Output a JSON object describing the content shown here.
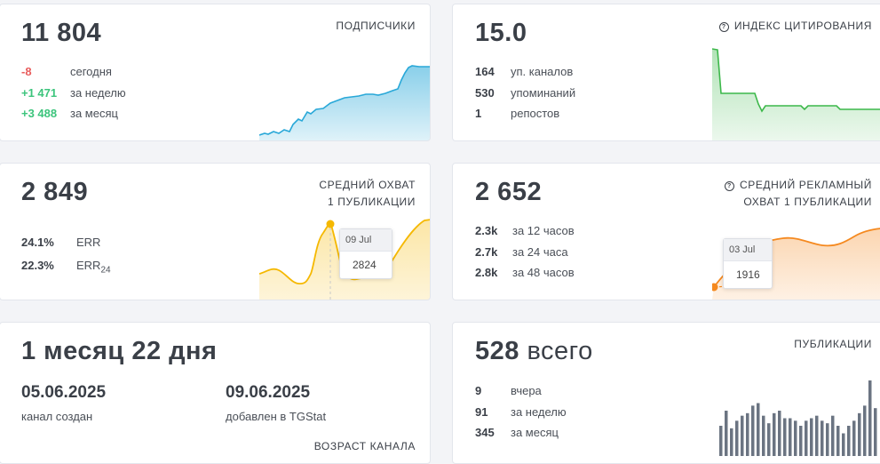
{
  "subscribers": {
    "value": "11 804",
    "label": "ПОДПИСЧИКИ",
    "rows": [
      {
        "num": "-8",
        "text": "сегодня"
      },
      {
        "num": "+1 471",
        "text": "за неделю"
      },
      {
        "num": "+3 488",
        "text": "за месяц"
      }
    ],
    "color": "#29a8d8"
  },
  "citation": {
    "value": "15.0",
    "label": "ИНДЕКС ЦИТИРОВАНИЯ",
    "icon": "question-circle-icon",
    "rows": [
      {
        "num": "164",
        "text": "уп. каналов"
      },
      {
        "num": "530",
        "text": "упоминаний"
      },
      {
        "num": "1",
        "text": "репостов"
      }
    ],
    "color": "#3cb84a"
  },
  "reach": {
    "value": "2 849",
    "label_line1": "СРЕДНИЙ ОХВАТ",
    "label_line2": "1 ПУБЛИКАЦИИ",
    "err_value": "24.1%",
    "err_label": "ERR",
    "err24_value": "22.3%",
    "err24_label": "ERR",
    "err24_sub": "24",
    "tooltip_date": "09 Jul",
    "tooltip_value": "2824",
    "color": "#f5b800"
  },
  "ad_reach": {
    "value": "2 652",
    "label_line1": "СРЕДНИЙ РЕКЛАМНЫЙ",
    "label_line2": "ОХВАТ 1 ПУБЛИКАЦИИ",
    "icon": "question-circle-icon",
    "rows": [
      {
        "num": "2.3k",
        "text": "за 12 часов"
      },
      {
        "num": "2.7k",
        "text": "за 24 часа"
      },
      {
        "num": "2.8k",
        "text": "за 48 часов"
      }
    ],
    "tooltip_date": "03 Jul",
    "tooltip_value": "1916",
    "color": "#f5891f"
  },
  "age": {
    "value": "1 месяц 22 дня",
    "created_date": "05.06.2025",
    "created_label": "канал создан",
    "added_date": "09.06.2025",
    "added_label": "добавлен в TGStat",
    "label": "ВОЗРАСТ КАНАЛА"
  },
  "publications": {
    "value": "528",
    "value_suffix": "всего",
    "label": "ПУБЛИКАЦИИ",
    "rows": [
      {
        "num": "9",
        "text": "вчера"
      },
      {
        "num": "91",
        "text": "за неделю"
      },
      {
        "num": "345",
        "text": "за месяц"
      }
    ],
    "bars": [
      12,
      18,
      11,
      14,
      16,
      17,
      20,
      21,
      16,
      13,
      17,
      18,
      15,
      15,
      14,
      12,
      14,
      15,
      16,
      14,
      13,
      16,
      12,
      9,
      12,
      14,
      17,
      20,
      30,
      19
    ],
    "color": "#6b7482"
  }
}
